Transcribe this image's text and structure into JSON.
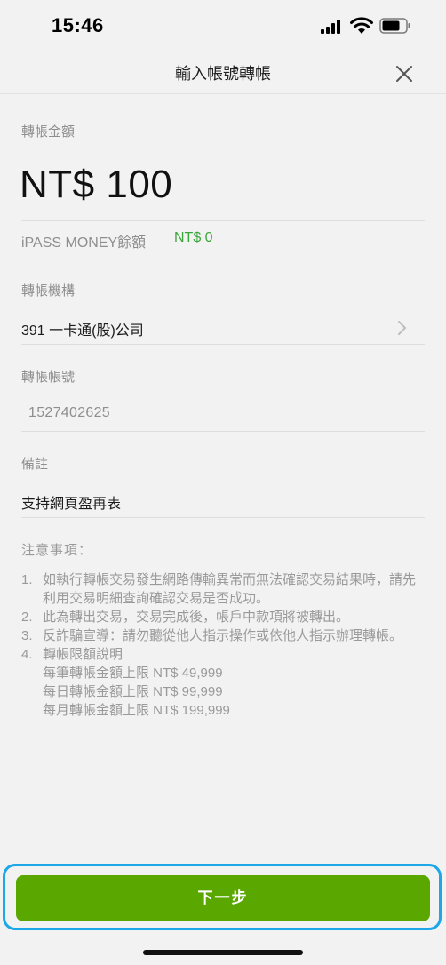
{
  "status_bar": {
    "time": "15:46"
  },
  "nav": {
    "title": "輸入帳號轉帳"
  },
  "transfer_amount": {
    "label": "轉帳金額",
    "value": "NT$ 100"
  },
  "balance": {
    "label": "iPASS MONEY餘額",
    "value": "NT$ 0"
  },
  "institution": {
    "label": "轉帳機構",
    "value": "391 一卡通(股)公司"
  },
  "account": {
    "label": "轉帳帳號",
    "value": "1527402625"
  },
  "memo": {
    "label": "備註",
    "value": "支持網頁盈再表"
  },
  "notes": {
    "title": "注意事項：",
    "items": [
      {
        "num": "1.",
        "text": "如執行轉帳交易發生網路傳輸異常而無法確認交易結果時，請先利用交易明細查詢確認交易是否成功。"
      },
      {
        "num": "2.",
        "text": "此為轉出交易，交易完成後，帳戶中款項將被轉出。"
      },
      {
        "num": "3.",
        "text": "反詐騙宣導：請勿聽從他人指示操作或依他人指示辦理轉帳。"
      },
      {
        "num": "4.",
        "text": "轉帳限額說明"
      }
    ],
    "limits": [
      "每筆轉帳金額上限 NT$ 49,999",
      "每日轉帳金額上限 NT$ 99,999",
      "每月轉帳金額上限 NT$ 199,999"
    ]
  },
  "next_button": {
    "label": "下一步"
  },
  "colors": {
    "accent": "#5aa700",
    "highlight": "#1ea7e8",
    "balance": "#3aa63a"
  }
}
